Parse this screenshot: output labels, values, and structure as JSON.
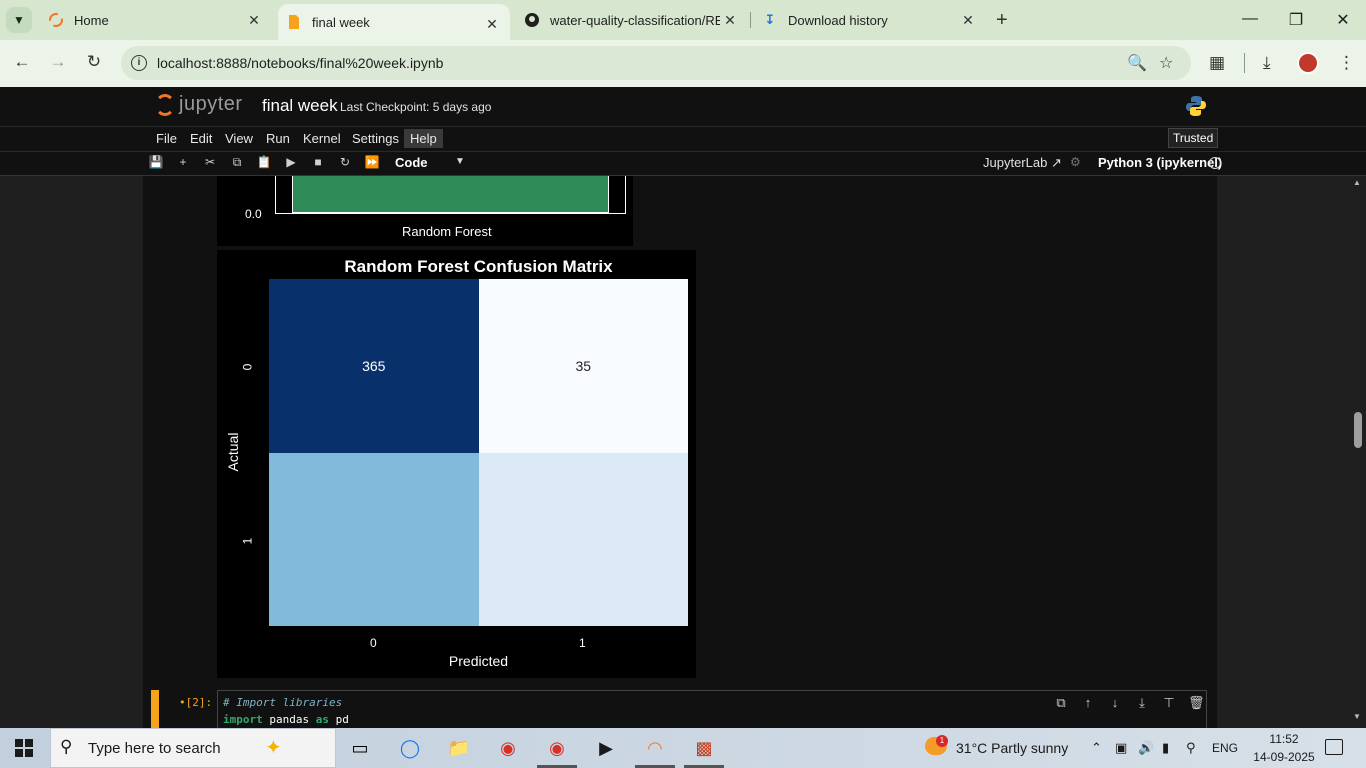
{
  "browser": {
    "tabs": [
      {
        "label": "Home",
        "icon": "jupyter-icon",
        "active": false
      },
      {
        "label": "final week",
        "icon": "notebook-icon",
        "active": true
      },
      {
        "label": "water-quality-classification/REA",
        "icon": "github-icon",
        "active": false
      },
      {
        "label": "Download history",
        "icon": "download-icon",
        "active": false
      }
    ],
    "url": "localhost:8888/notebooks/final%20week.ipynb"
  },
  "jupyter": {
    "logo_text": "jupyter",
    "notebook_title": "final week",
    "checkpoint": "Last Checkpoint: 5 days ago",
    "menu": [
      "File",
      "Edit",
      "View",
      "Run",
      "Kernel",
      "Settings",
      "Help"
    ],
    "active_menu": "Help",
    "trusted": "Trusted",
    "cell_type": "Code",
    "jupyterlab_link": "JupyterLab",
    "kernel": "Python 3 (ipykernel)"
  },
  "bar_chart_fragment": {
    "ytick": "0.0",
    "category": "Random Forest",
    "bar_color": "#2e8b57"
  },
  "chart_data": {
    "type": "heatmap",
    "title": "Random Forest Confusion Matrix",
    "xlabel": "Predicted",
    "ylabel": "Actual",
    "x_ticks": [
      "0",
      "1"
    ],
    "y_ticks": [
      "0",
      "1"
    ],
    "values": [
      [
        365,
        35
      ],
      [
        null,
        null
      ]
    ],
    "cell_labels": [
      [
        "365",
        "35"
      ],
      [
        "",
        ""
      ]
    ],
    "colormap": "Blues",
    "cell_colors": [
      [
        "#08306b",
        "#f7fbff"
      ],
      [
        "#82badb",
        "#dbe9f6"
      ]
    ]
  },
  "code_cell": {
    "prompt": "•[2]:",
    "comment": "# Import libraries",
    "line2": {
      "kw1": "import",
      "mod": "pandas",
      "kw2": "as",
      "alias": "pd"
    }
  },
  "taskbar": {
    "search_placeholder": "Type here to search",
    "weather": "31°C  Partly sunny",
    "weather_badge": "1",
    "lang": "ENG",
    "time": "11:52",
    "date": "14-09-2025"
  }
}
